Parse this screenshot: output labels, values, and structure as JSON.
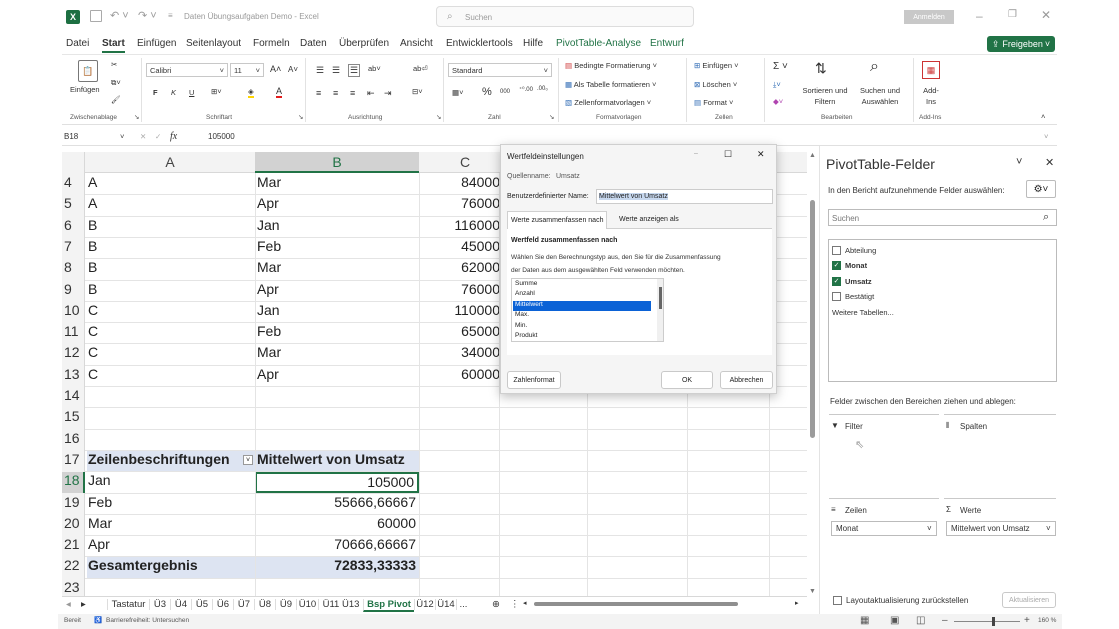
{
  "title_bar": {
    "autosave_label": "",
    "file_name": "Daten Übungsaufgaben Demo",
    "app": "Excel",
    "search_placeholder": "Suchen",
    "signin": "Anmelden"
  },
  "menu_tabs": [
    "Datei",
    "Start",
    "Einfügen",
    "Seitenlayout",
    "Formeln",
    "Daten",
    "Überprüfen",
    "Ansicht",
    "Entwicklertools",
    "Hilfe",
    "PivotTable-Analyse",
    "Entwurf"
  ],
  "share_button": "Freigeben",
  "ribbon": {
    "clipboard": {
      "paste": "Einfügen",
      "group": "Zwischenablage"
    },
    "font": {
      "name": "Calibri",
      "size": "11",
      "bold": "F",
      "italic": "K",
      "underline": "U",
      "grow": "A˄",
      "shrink": "A˅",
      "group": "Schriftart"
    },
    "alignment": {
      "group": "Ausrichtung"
    },
    "number": {
      "format": "Standard",
      "percent": "%",
      "thousands": "000",
      "group": "Zahl"
    },
    "styles": {
      "conditional": "Bedingte Formatierung",
      "table": "Als Tabelle formatieren",
      "cell": "Zellenformatvorlagen",
      "group": "Formatvorlagen"
    },
    "cells": {
      "insert": "Einfügen",
      "delete": "Löschen",
      "format": "Format",
      "group": "Zellen"
    },
    "editing": {
      "sort": "Sortieren und Filtern",
      "find": "Suchen und Auswählen",
      "group": "Bearbeiten"
    },
    "addins": {
      "label": "Add-Ins",
      "group": "Add-Ins"
    }
  },
  "formula_bar": {
    "name_box": "B18",
    "fx": "fx",
    "value": "105000"
  },
  "columns": [
    "A",
    "B",
    "C"
  ],
  "rows": [
    {
      "n": "4",
      "a": "A",
      "b": "Mar",
      "c": "84000"
    },
    {
      "n": "5",
      "a": "A",
      "b": "Apr",
      "c": "76000"
    },
    {
      "n": "6",
      "a": "B",
      "b": "Jan",
      "c": "116000"
    },
    {
      "n": "7",
      "a": "B",
      "b": "Feb",
      "c": "45000"
    },
    {
      "n": "8",
      "a": "B",
      "b": "Mar",
      "c": "62000"
    },
    {
      "n": "9",
      "a": "B",
      "b": "Apr",
      "c": "76000"
    },
    {
      "n": "10",
      "a": "C",
      "b": "Jan",
      "c": "110000"
    },
    {
      "n": "11",
      "a": "C",
      "b": "Feb",
      "c": "65000"
    },
    {
      "n": "12",
      "a": "C",
      "b": "Mar",
      "c": "34000"
    },
    {
      "n": "13",
      "a": "C",
      "b": "Apr",
      "c": "60000"
    },
    {
      "n": "14",
      "a": "",
      "b": "",
      "c": ""
    },
    {
      "n": "15",
      "a": "",
      "b": "",
      "c": ""
    },
    {
      "n": "16",
      "a": "",
      "b": "",
      "c": ""
    },
    {
      "n": "17",
      "a": "Zeilenbeschriftungen",
      "b": "Mittelwert von Umsatz",
      "c": ""
    },
    {
      "n": "18",
      "a": "Jan",
      "b": "105000",
      "c": ""
    },
    {
      "n": "19",
      "a": "Feb",
      "b": "55666,66667",
      "c": ""
    },
    {
      "n": "20",
      "a": "Mar",
      "b": "60000",
      "c": ""
    },
    {
      "n": "21",
      "a": "Apr",
      "b": "70666,66667",
      "c": ""
    },
    {
      "n": "22",
      "a": "Gesamtergebnis",
      "b": "72833,33333",
      "c": ""
    },
    {
      "n": "23",
      "a": "",
      "b": "",
      "c": ""
    }
  ],
  "dialog": {
    "title": "Wertfeldeinstellungen",
    "source_label": "Quellenname:",
    "source_value": "Umsatz",
    "custom_label": "Benutzerdefinierter Name:",
    "custom_value": "Mittelwert von Umsatz",
    "tab1": "Werte zusammenfassen nach",
    "tab2": "Werte anzeigen als",
    "section": "Wertfeld zusammenfassen nach",
    "desc1": "Wählen Sie den Berechnungstyp aus, den Sie für die Zusammenfassung",
    "desc2": "der Daten aus dem ausgewählten Feld verwenden möchten.",
    "options": [
      "Summe",
      "Anzahl",
      "Mittelwert",
      "Max.",
      "Min.",
      "Produkt"
    ],
    "selected": "Mittelwert",
    "number_format": "Zahlenformat",
    "ok": "OK",
    "cancel": "Abbrechen"
  },
  "pivot_pane": {
    "title": "PivotTable-Felder",
    "subtitle": "In den Bericht aufzunehmende Felder auswählen:",
    "search_placeholder": "Suchen",
    "fields": [
      {
        "label": "Abteilung",
        "checked": false
      },
      {
        "label": "Monat",
        "checked": true
      },
      {
        "label": "Umsatz",
        "checked": true
      },
      {
        "label": "Bestätigt",
        "checked": false
      }
    ],
    "more_tables": "Weitere Tabellen...",
    "drag_hint": "Felder zwischen den Bereichen ziehen und ablegen:",
    "filter": "Filter",
    "columns": "Spalten",
    "rows": "Zeilen",
    "values": "Werte",
    "rows_item": "Monat",
    "values_item": "Mittelwert von Umsatz",
    "defer": "Layoutaktualisierung zurückstellen",
    "update": "Aktualisieren"
  },
  "sheet_tabs": [
    "Tastatur",
    "Ü3",
    "Ü4",
    "Ü5",
    "Ü6",
    "Ü7",
    "Ü8",
    "Ü9",
    "Ü10",
    "Ü11 Ü13",
    "Bsp Pivot",
    "Ü12",
    "Ü14",
    "..."
  ],
  "active_sheet": "Bsp Pivot",
  "status": {
    "ready": "Bereit",
    "accessibility": "Barrierefreiheit: Untersuchen",
    "zoom": "160 %"
  }
}
